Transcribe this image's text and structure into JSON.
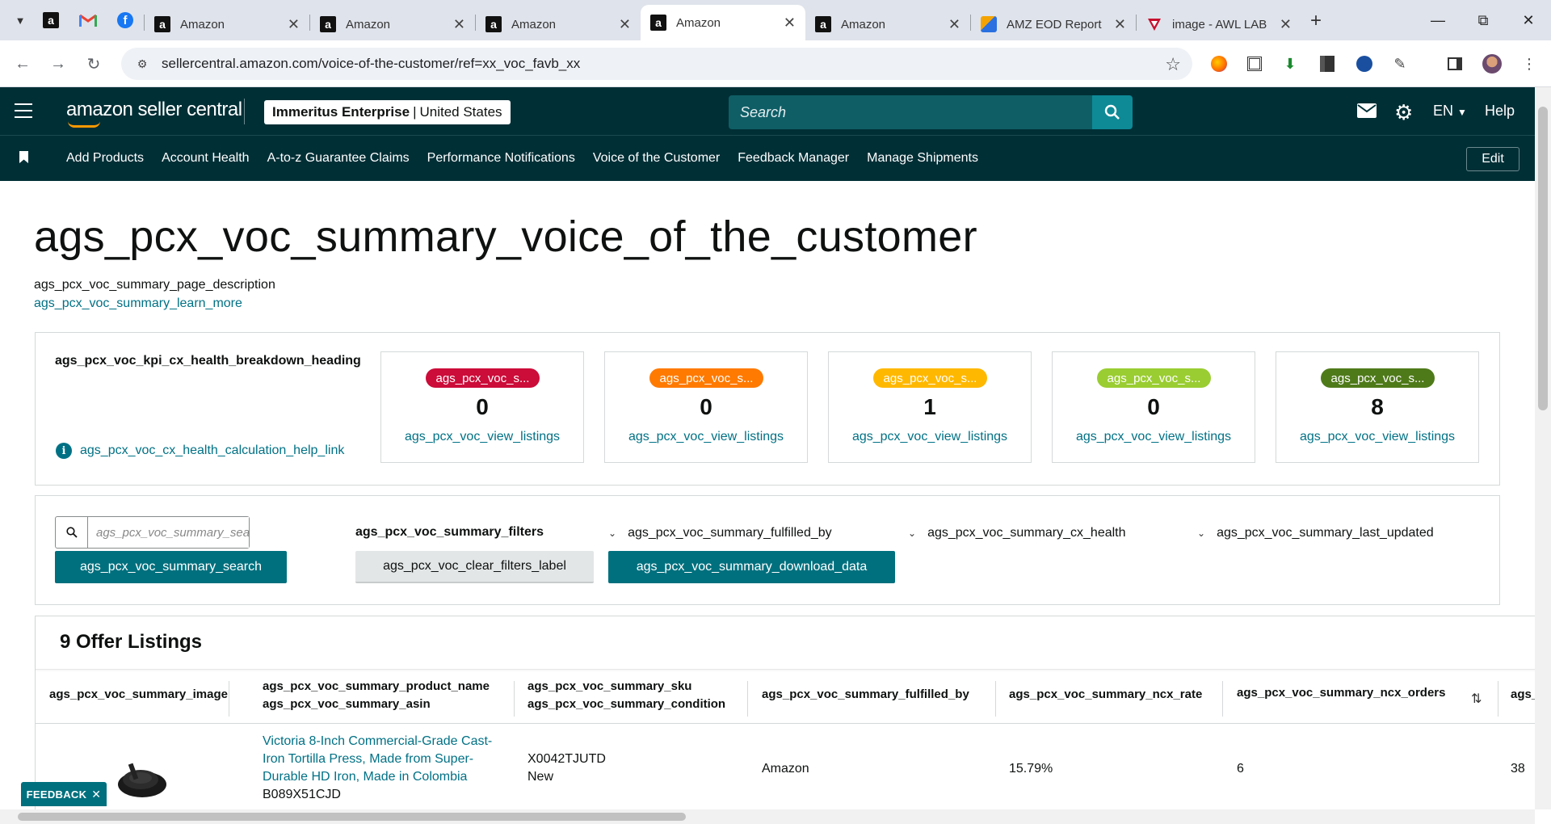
{
  "browser": {
    "tabs": [
      {
        "title": "Amazon",
        "favicon": "amazon-icon",
        "active": false
      },
      {
        "title": "Amazon",
        "favicon": "amazon-icon",
        "active": false
      },
      {
        "title": "Amazon",
        "favicon": "amazon-icon",
        "active": false
      },
      {
        "title": "Amazon",
        "favicon": "amazon-icon",
        "active": true
      },
      {
        "title": "Amazon",
        "favicon": "amazon-icon",
        "active": false
      },
      {
        "title": "AMZ EOD Report",
        "favicon": "eod-report-icon",
        "active": false
      },
      {
        "title": "image - AWL LAB",
        "favicon": "image-icon",
        "active": false
      }
    ],
    "url": "sellercentral.amazon.com/voice-of-the-customer/ref=xx_voc_favb_xx"
  },
  "header": {
    "logo_text": "amazon seller central",
    "store_name": "Immeritus Enterprise",
    "store_region": "United States",
    "search_placeholder": "Search",
    "language": "EN",
    "help": "Help"
  },
  "nav": {
    "items": [
      "Add Products",
      "Account Health",
      "A-to-z Guarantee Claims",
      "Performance Notifications",
      "Voice of the Customer",
      "Feedback Manager",
      "Manage Shipments"
    ],
    "edit_label": "Edit"
  },
  "page": {
    "title": "ags_pcx_voc_summary_voice_of_the_customer",
    "description": "ags_pcx_voc_summary_page_description",
    "learn_more": "ags_pcx_voc_summary_learn_more"
  },
  "kpi": {
    "heading": "ags_pcx_voc_kpi_cx_health_breakdown_heading",
    "help_link": "ags_pcx_voc_cx_health_calculation_help_link",
    "cards": [
      {
        "badge": "ags_pcx_voc_s...",
        "color": "#cc0c39",
        "count": "0",
        "link": "ags_pcx_voc_view_listings"
      },
      {
        "badge": "ags_pcx_voc_s...",
        "color": "#ff7a00",
        "count": "0",
        "link": "ags_pcx_voc_view_listings"
      },
      {
        "badge": "ags_pcx_voc_s...",
        "color": "#ffb800",
        "count": "1",
        "link": "ags_pcx_voc_view_listings"
      },
      {
        "badge": "ags_pcx_voc_s...",
        "color": "#9acd32",
        "count": "0",
        "link": "ags_pcx_voc_view_listings"
      },
      {
        "badge": "ags_pcx_voc_s...",
        "color": "#4f7a1a",
        "count": "8",
        "link": "ags_pcx_voc_view_listings"
      }
    ]
  },
  "filters": {
    "search_placeholder": "ags_pcx_voc_summary_search_placeholder",
    "search_button": "ags_pcx_voc_summary_search",
    "filters_label": "ags_pcx_voc_summary_filters",
    "clear_filters": "ags_pcx_voc_clear_filters_label",
    "download": "ags_pcx_voc_summary_download_data",
    "dropdowns": [
      "ags_pcx_voc_summary_fulfilled_by",
      "ags_pcx_voc_summary_cx_health",
      "ags_pcx_voc_summary_last_updated"
    ]
  },
  "listings": {
    "title": "9 Offer Listings",
    "columns": {
      "image": "ags_pcx_voc_summary_image",
      "product_name": "ags_pcx_voc_summary_product_name",
      "asin": "ags_pcx_voc_summary_asin",
      "sku": "ags_pcx_voc_summary_sku",
      "condition": "ags_pcx_voc_summary_condition",
      "fulfilled_by": "ags_pcx_voc_summary_fulfilled_by",
      "ncx_rate": "ags_pcx_voc_summary_ncx_rate",
      "ncx_orders": "ags_pcx_voc_summary_ncx_orders",
      "next": "ags_"
    },
    "rows": [
      {
        "product_name": "Victoria 8-Inch Commercial-Grade Cast-Iron Tortilla Press, Made from Super-Durable HD Iron, Made in Colombia",
        "asin": "B089X51CJD",
        "sku": "X0042TJUTD",
        "condition": "New",
        "fulfilled_by": "Amazon",
        "ncx_rate": "15.79%",
        "ncx_orders": "6",
        "next": "38"
      }
    ]
  },
  "feedback": "FEEDBACK"
}
